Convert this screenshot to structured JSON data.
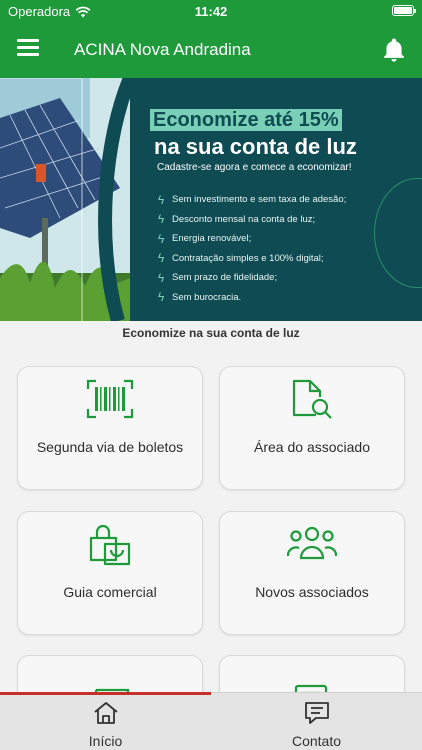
{
  "status_bar": {
    "carrier": "Operadora",
    "time": "11:42"
  },
  "app_bar": {
    "title": "ACINA Nova Andradina"
  },
  "banner": {
    "headline_line1": "Economize até 15%",
    "headline_line2": "na sua conta de luz",
    "cta": "Cadastre-se agora e comece a economizar!",
    "benefits": [
      "Sem investimento e sem taxa de adesão;",
      "Desconto mensal na conta de luz;",
      "Energia renovável;",
      "Contratação simples e 100% digital;",
      "Sem prazo de fidelidade;",
      "Sem burocracia."
    ]
  },
  "section_label": "Economize na sua conta de luz",
  "cards": [
    {
      "label": "Segunda via de boletos",
      "icon": "barcode-icon"
    },
    {
      "label": "Área do associado",
      "icon": "document-search-icon"
    },
    {
      "label": "Guia comercial",
      "icon": "shopping-bag-icon"
    },
    {
      "label": "Novos associados",
      "icon": "group-icon"
    },
    {
      "label": "",
      "icon": "newspaper-icon"
    },
    {
      "label": "",
      "icon": "list-document-icon"
    }
  ],
  "bottom_nav": {
    "home_label": "Início",
    "contact_label": "Contato"
  },
  "colors": {
    "primary": "#1e9a3b",
    "banner_bg": "#0e4b52",
    "accent": "#7ad0b7",
    "active_indicator": "#c6302b"
  }
}
